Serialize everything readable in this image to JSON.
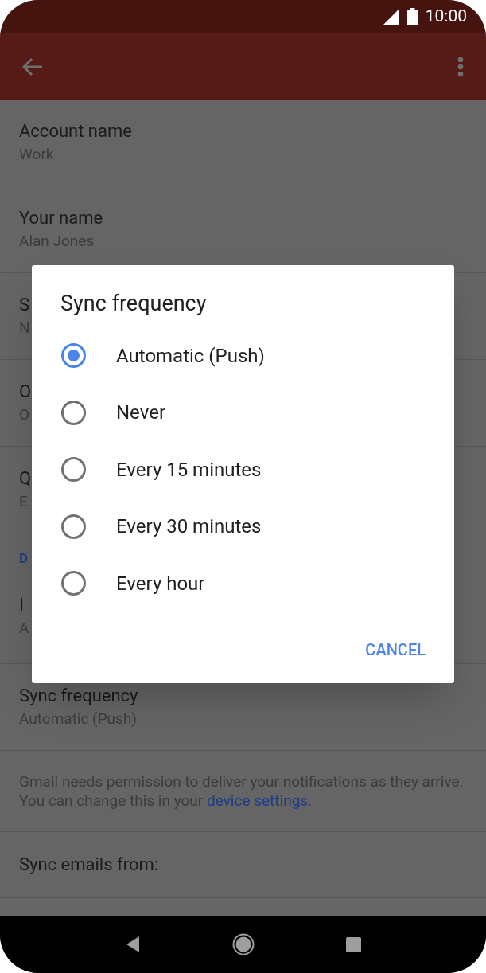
{
  "status_bar": {
    "time": "10:00"
  },
  "settings": [
    {
      "kind": "row",
      "title": "Account name",
      "subtitle": "Work"
    },
    {
      "kind": "row",
      "title": "Your name",
      "subtitle": "Alan Jones"
    },
    {
      "kind": "row",
      "title": "S",
      "subtitle": "N"
    },
    {
      "kind": "row",
      "title": "O",
      "subtitle": "O"
    },
    {
      "kind": "row",
      "title": "Q",
      "subtitle": "E"
    },
    {
      "kind": "header",
      "title": "D"
    },
    {
      "kind": "row",
      "title": "I",
      "subtitle": "A"
    },
    {
      "kind": "row",
      "title": "Sync frequency",
      "subtitle": "Automatic (Push)"
    },
    {
      "kind": "note",
      "text": "Gmail needs permission to deliver your notifications as they arrive. You can change this in your ",
      "link": "device settings",
      "after": "."
    },
    {
      "kind": "row",
      "title": "Sync emails from:"
    },
    {
      "kind": "blank"
    }
  ],
  "dialog": {
    "title": "Sync frequency",
    "options": [
      {
        "label": "Automatic (Push)",
        "selected": true
      },
      {
        "label": "Never",
        "selected": false
      },
      {
        "label": "Every 15 minutes",
        "selected": false
      },
      {
        "label": "Every 30 minutes",
        "selected": false
      },
      {
        "label": "Every hour",
        "selected": false
      }
    ],
    "button": "CANCEL"
  }
}
